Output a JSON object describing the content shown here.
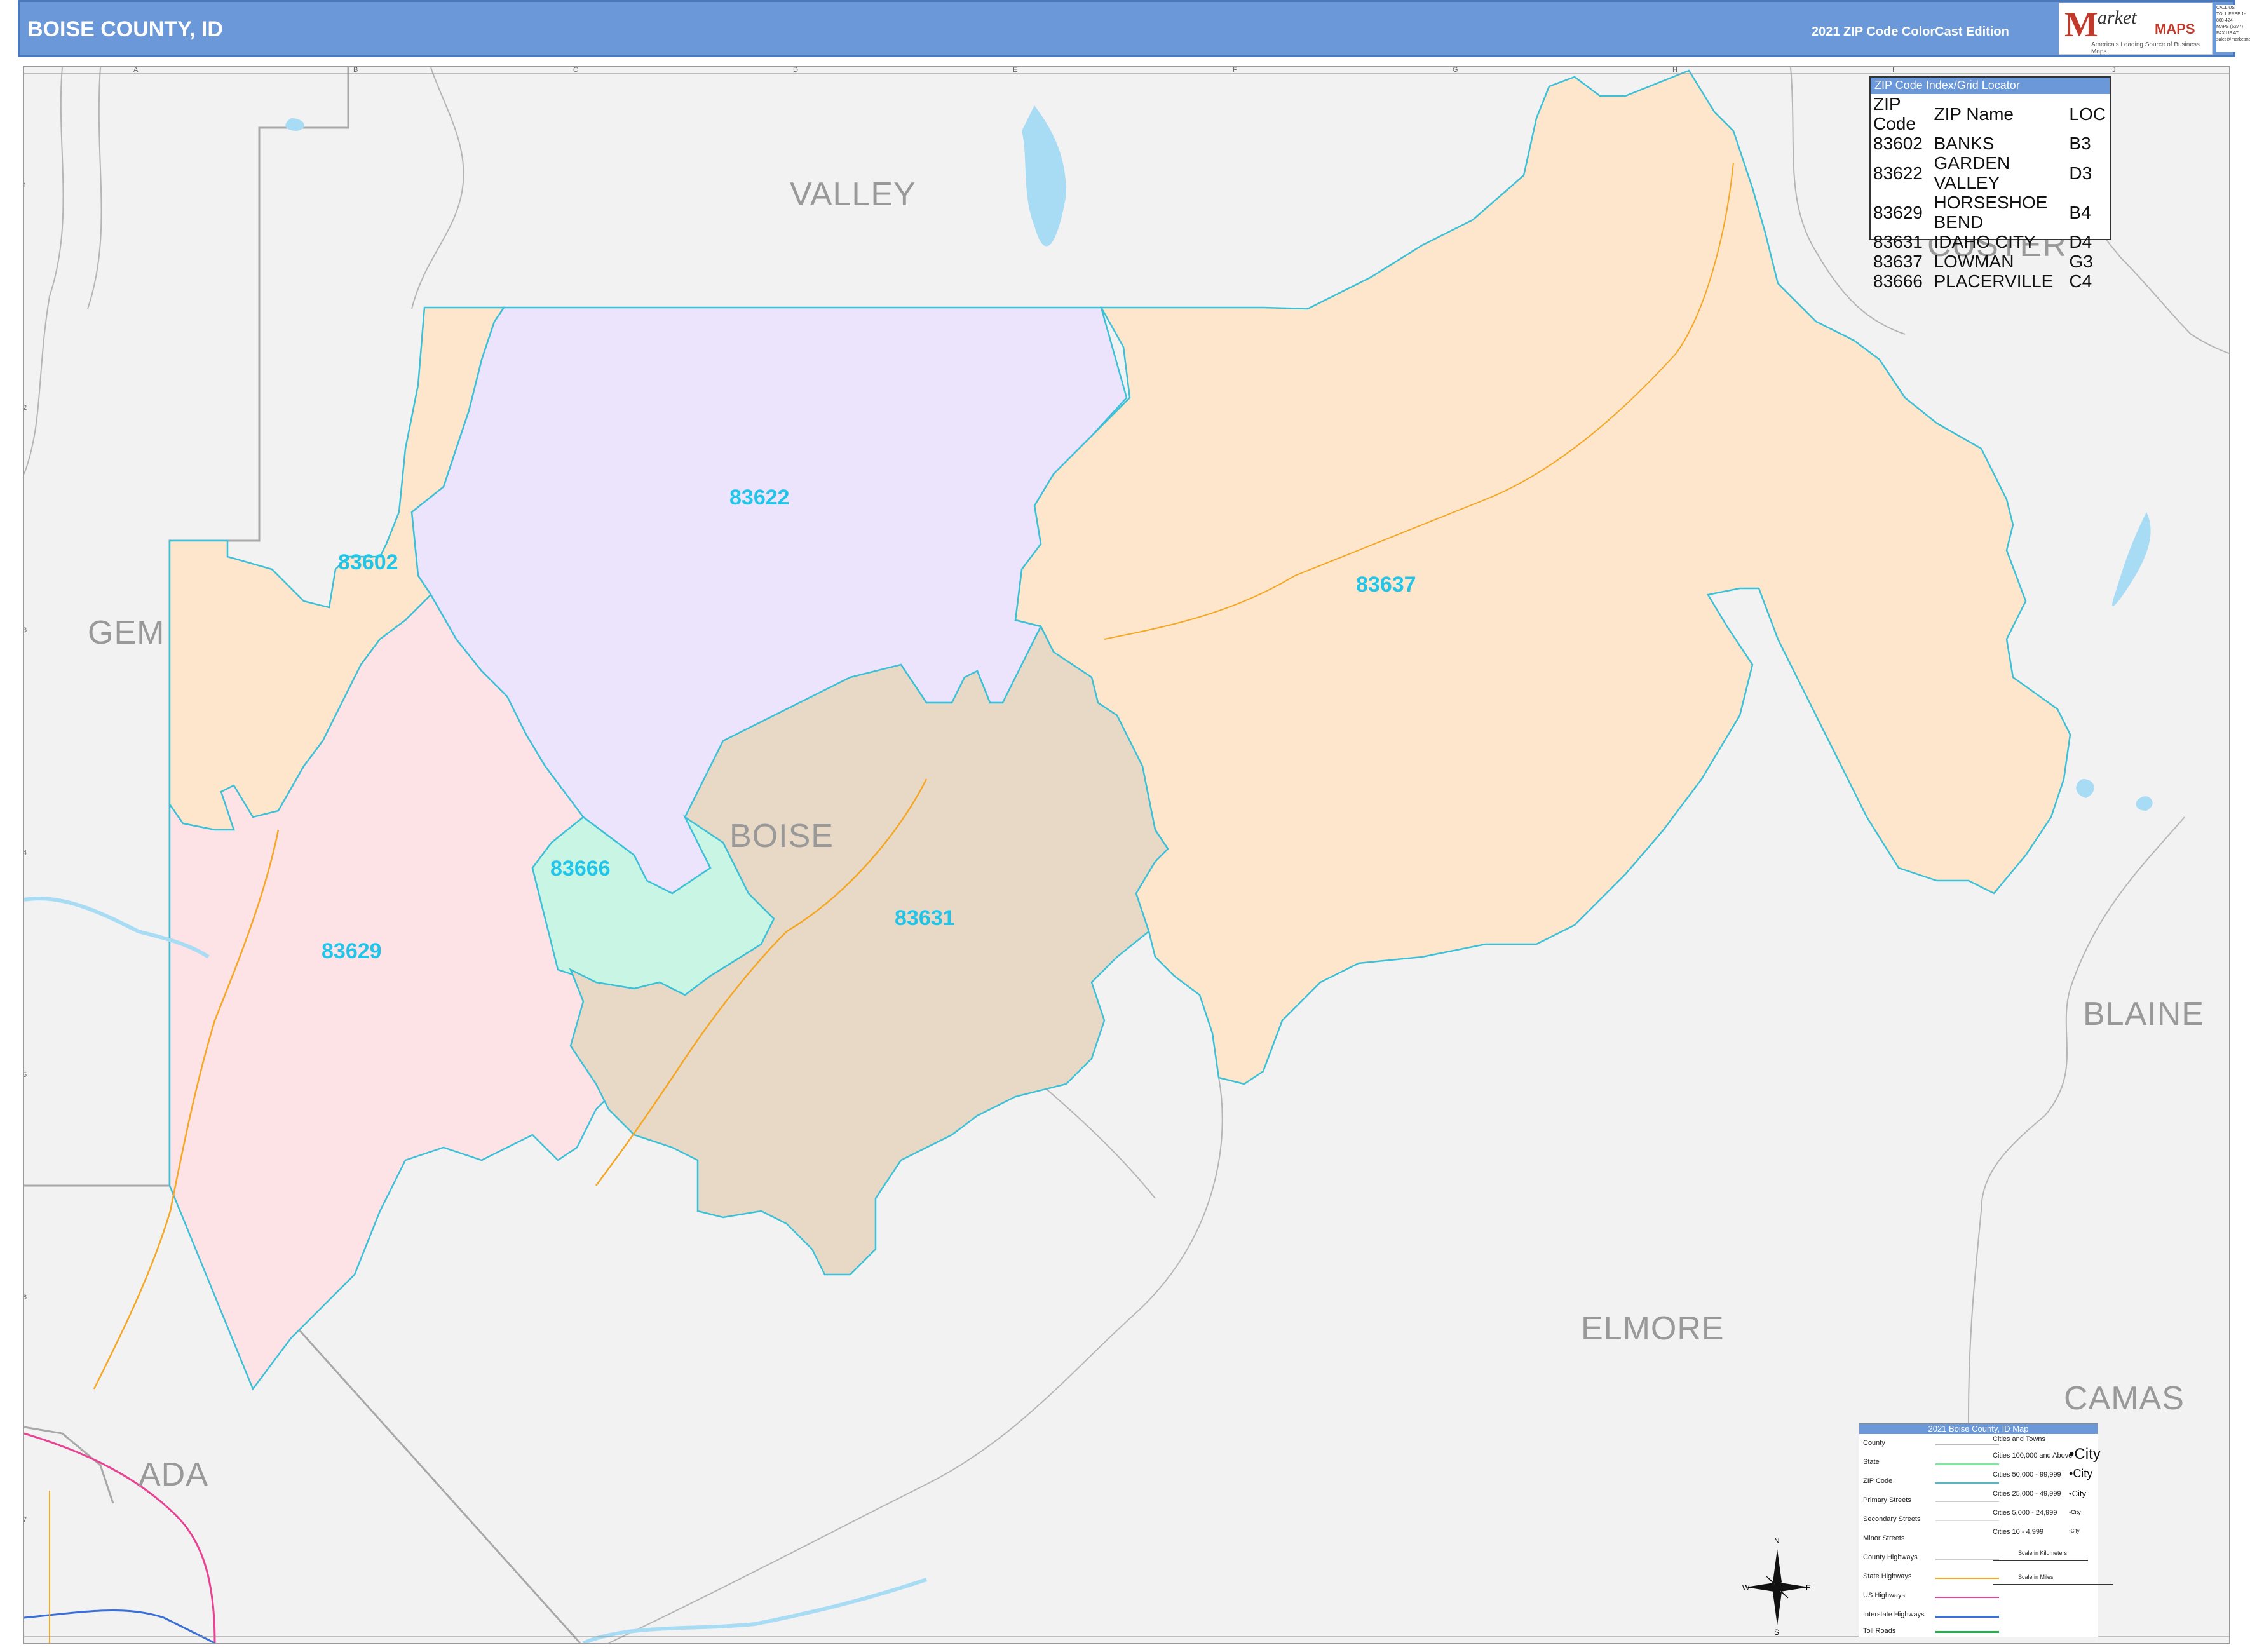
{
  "header": {
    "title": "BOISE COUNTY, ID",
    "edition": "2021 ZIP Code ColorCast Edition",
    "logo_mark": "M",
    "logo_text": "arket",
    "logo_maps": "MAPS",
    "logo_tagline": "America's Leading Source of Business Maps",
    "logo_contact": "CALL US TOLL FREE 1-800-424-MAPS (6277) FAX US AT sales@marketmaps.com"
  },
  "counties": {
    "valley": "VALLEY",
    "custer": "CUSTER",
    "gem": "GEM",
    "boise": "BOISE",
    "blaine": "BLAINE",
    "elmore": "ELMORE",
    "camas": "CAMAS",
    "ada": "ADA"
  },
  "zip_labels": {
    "z83602": "83602",
    "z83622": "83622",
    "z83629": "83629",
    "z83631": "83631",
    "z83637": "83637",
    "z83666": "83666"
  },
  "zip_colors": {
    "83602": "#fde6cc",
    "83622": "#ece4fd",
    "83629": "#fde2e6",
    "83631": "#e8d9c6",
    "83637": "#fde6cc",
    "83666": "#c8f5e4"
  },
  "zip_index": {
    "title": "ZIP Code Index/Grid Locator",
    "headers": [
      "ZIP Code",
      "ZIP Name",
      "LOC"
    ],
    "rows": [
      [
        "83602",
        "BANKS",
        "B3"
      ],
      [
        "83622",
        "GARDEN VALLEY",
        "D3"
      ],
      [
        "83629",
        "HORSESHOE BEND",
        "B4"
      ],
      [
        "83631",
        "IDAHO CITY",
        "D4"
      ],
      [
        "83637",
        "LOWMAN",
        "G3"
      ],
      [
        "83666",
        "PLACERVILLE",
        "C4"
      ]
    ]
  },
  "grid": {
    "letters": [
      "A",
      "B",
      "C",
      "D",
      "E",
      "F",
      "G",
      "H",
      "I",
      "J"
    ],
    "numbers": [
      "1",
      "2",
      "3",
      "4",
      "5",
      "6",
      "7"
    ]
  },
  "legend": {
    "title": "2021 Boise County, ID Map",
    "items": [
      "County",
      "State",
      "ZIP Code",
      "Primary Streets",
      "Secondary Streets",
      "Minor Streets",
      "County Highways",
      "State Highways",
      "US Highways",
      "Interstate Highways",
      "Toll Roads"
    ],
    "cities_heading": "Cities and Towns",
    "city_ranges": [
      "Cities 100,000 and Above",
      "Cities 50,000 - 99,999",
      "Cities 25,000 - 49,999",
      "Cities 5,000 - 24,999",
      "Cities 10 - 4,999"
    ],
    "city_examples": [
      "City",
      "City",
      "City",
      "City",
      "City"
    ],
    "scale_km": "Scale in Kilometers",
    "scale_mi": "Scale in Miles"
  },
  "compass": {
    "n": "N",
    "s": "S",
    "e": "E",
    "w": "W"
  },
  "colors": {
    "header_bg": "#6a98d8",
    "zip_label": "#22c4e8",
    "zip_border": "#3cc0d8",
    "water": "#a8dcf4",
    "background": "#f2f2f2"
  }
}
